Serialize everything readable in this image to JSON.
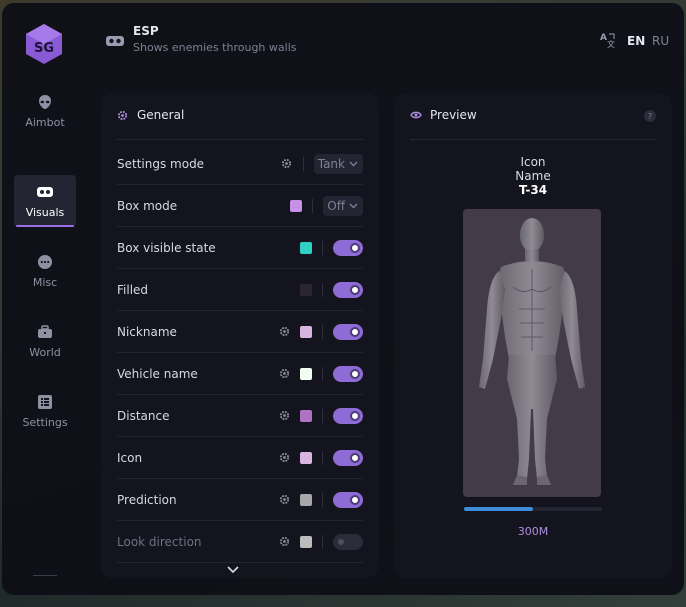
{
  "header": {
    "title": "ESP",
    "subtitle": "Shows enemies through walls",
    "languages": [
      "EN",
      "RU"
    ],
    "active_language": "EN"
  },
  "sidebar": {
    "items": [
      {
        "label": "Aimbot",
        "icon": "alien-head-icon",
        "active": false
      },
      {
        "label": "Visuals",
        "icon": "vr-goggles-icon",
        "active": true
      },
      {
        "label": "Misc",
        "icon": "dots-circle-icon",
        "active": false
      },
      {
        "label": "World",
        "icon": "briefcase-icon",
        "active": false
      },
      {
        "label": "Settings",
        "icon": "list-icon",
        "active": false
      }
    ]
  },
  "general": {
    "title": "General",
    "rows": [
      {
        "label": "Settings mode",
        "gear": true,
        "select": "Tank"
      },
      {
        "label": "Box mode",
        "swatch": "#c890e6",
        "select": "Off"
      },
      {
        "label": "Box visible state",
        "swatch": "#2fd1c4",
        "toggle": true
      },
      {
        "label": "Filled",
        "swatch": "#2b2433",
        "toggle": true
      },
      {
        "label": "Nickname",
        "gear": true,
        "swatch": "#d8b4e0",
        "toggle": true
      },
      {
        "label": "Vehicle name",
        "gear": true,
        "swatch": "#f2fff2",
        "toggle": true
      },
      {
        "label": "Distance",
        "gear": true,
        "swatch": "#b072c4",
        "toggle": true
      },
      {
        "label": "Icon",
        "gear": true,
        "swatch": "#d8b4e0",
        "toggle": true
      },
      {
        "label": "Prediction",
        "gear": true,
        "swatch": "#a7a7a7",
        "toggle": true
      },
      {
        "label": "Look direction",
        "gear": true,
        "swatch": "#bdbdbd",
        "toggle": false,
        "dim": true
      }
    ]
  },
  "preview": {
    "title": "Preview",
    "help": "?",
    "icon_label": "Icon",
    "name_label": "Name",
    "vehicle_label": "T-34",
    "distance": "300M",
    "health_fraction": 0.5
  },
  "colors": {
    "accent": "#9a6ee8",
    "toggle_on": "#8f6bd6",
    "progress": "#3d8bd9"
  }
}
